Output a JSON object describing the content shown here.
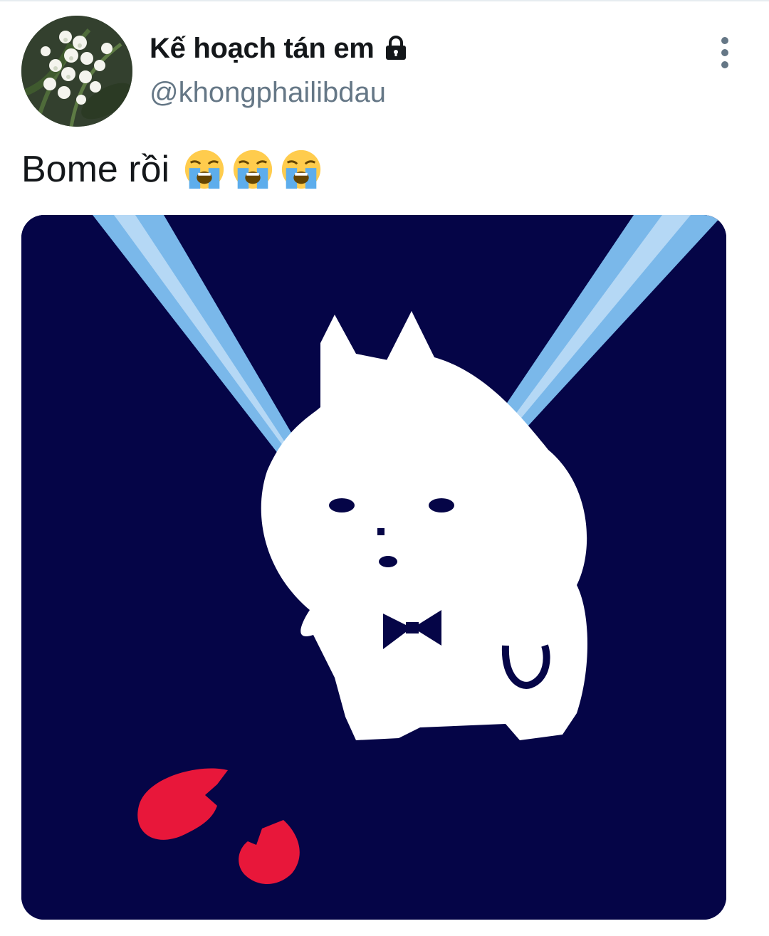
{
  "tweet": {
    "author": {
      "display_name": "Kế hoạch tán em",
      "handle": "@khongphailibdau",
      "avatar_icon": "lily-of-the-valley-avatar",
      "protected_icon": "lock-icon"
    },
    "more_icon": "more-vertical-icon",
    "text": "Bome rồi",
    "emoji": [
      "loudly-crying-face",
      "loudly-crying-face",
      "loudly-crying-face"
    ],
    "media": {
      "description_icon": "crying-cat-with-broken-heart-image"
    }
  },
  "colors": {
    "text_primary": "#14171a",
    "text_secondary": "#657786",
    "media_background": "#050547",
    "tears": "#7ab8ea",
    "heart": "#e8173a"
  }
}
